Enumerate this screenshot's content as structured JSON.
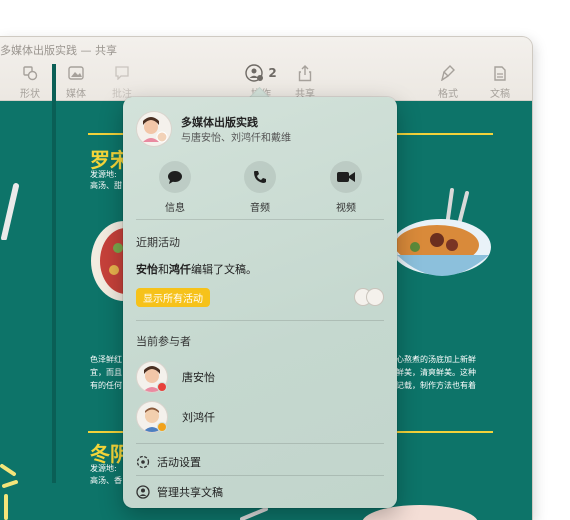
{
  "window": {
    "title": "多媒体出版实践",
    "title_suffix": "— 共享"
  },
  "toolbar": {
    "shape": "形状",
    "media": "媒体",
    "comment": "批注",
    "collaborate": "协作",
    "collaborator_count": "2",
    "share": "共享",
    "format": "格式",
    "document": "文稿"
  },
  "document": {
    "heading_1": "罗宋",
    "origin_label_1": "发源地:",
    "origin_value_1": "高汤、甜",
    "para_left_1": "色泽鲜红",
    "para_left_2": "宜，而且",
    "para_left_3": "有的任何",
    "para_right_1": "心熬煮的汤底加上新鲜",
    "para_right_2": "鲜美，清爽鲜美。这种",
    "para_right_3": "记载，制作方法也有着",
    "heading_2": "冬阴",
    "origin_label_2": "发源地:",
    "origin_value_2": "高汤、香"
  },
  "popover": {
    "doc_name": "多媒体出版实践",
    "shared_with": "与唐安怡、刘鸿仟和戴维",
    "actions": [
      {
        "label": "信息"
      },
      {
        "label": "音频"
      },
      {
        "label": "视频"
      }
    ],
    "recent_header": "近期活动",
    "activity_name_1": "安怡",
    "activity_and": "和",
    "activity_name_2": "鸿仟",
    "activity_text": "编辑了文稿。",
    "show_all": "显示所有活动",
    "participants_header": "当前参与者",
    "participants": [
      {
        "name": "唐安怡",
        "status_color": "#e8403a"
      },
      {
        "name": "刘鸿仟",
        "status_color": "#f2a21b"
      }
    ],
    "activity_settings": "活动设置",
    "manage_share": "管理共享文稿"
  },
  "colors": {
    "canvas": "#0d7469",
    "heading": "#f4d63a",
    "show_all_bg": "#f6c21a"
  }
}
